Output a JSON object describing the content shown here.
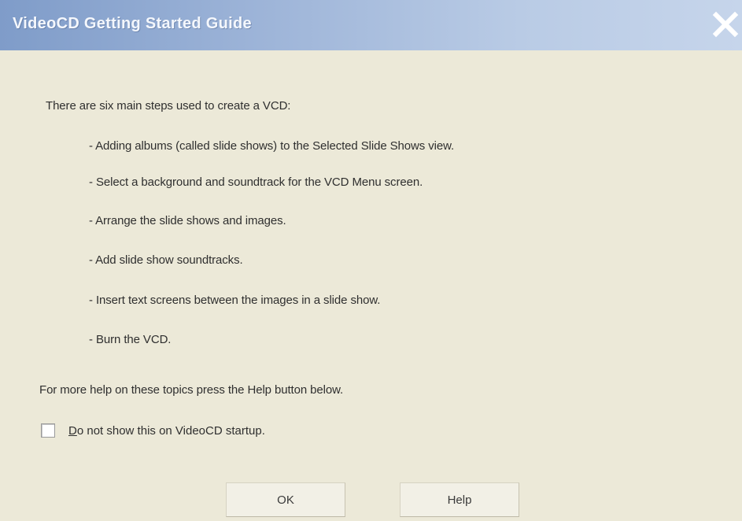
{
  "window": {
    "title": "VideoCD Getting Started Guide",
    "close_icon": "close-icon"
  },
  "content": {
    "intro": "There are six main steps used to create a VCD:",
    "steps": [
      "- Adding albums (called slide shows) to the Selected Slide Shows view.",
      "- Select a background and soundtrack for the VCD Menu screen.",
      "- Arrange the slide shows and images.",
      "- Add slide show soundtracks.",
      "- Insert text screens between the images in a slide show.",
      "- Burn the VCD."
    ],
    "footer": "For more help on these topics press the Help button below."
  },
  "checkbox": {
    "mnemonic": "D",
    "label_rest": "o not show this on VideoCD startup.",
    "checked": false
  },
  "buttons": {
    "ok_label": "OK",
    "help_label": "Help"
  },
  "colors": {
    "titlebar_start": "#7f9cc9",
    "titlebar_end": "#c6d5eb",
    "dialog_background": "#ece9d8",
    "close_x": "#ffffff"
  }
}
